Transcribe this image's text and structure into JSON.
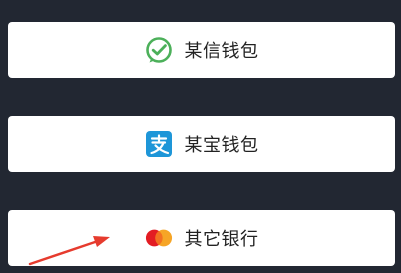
{
  "buttons": [
    {
      "label": "某信钱包",
      "icon": "wechat-pay-icon",
      "icon_color": "#4cb05a"
    },
    {
      "label": "某宝钱包",
      "icon": "alipay-icon",
      "icon_color": "#1e96d8"
    },
    {
      "label": "其它银行",
      "icon": "mastercard-icon",
      "icon_colors": [
        "#e31c23",
        "#f6a01a"
      ]
    }
  ],
  "annotation": {
    "arrow_color": "#e63b2e"
  },
  "colors": {
    "background": "#222732",
    "button": "#ffffff"
  }
}
